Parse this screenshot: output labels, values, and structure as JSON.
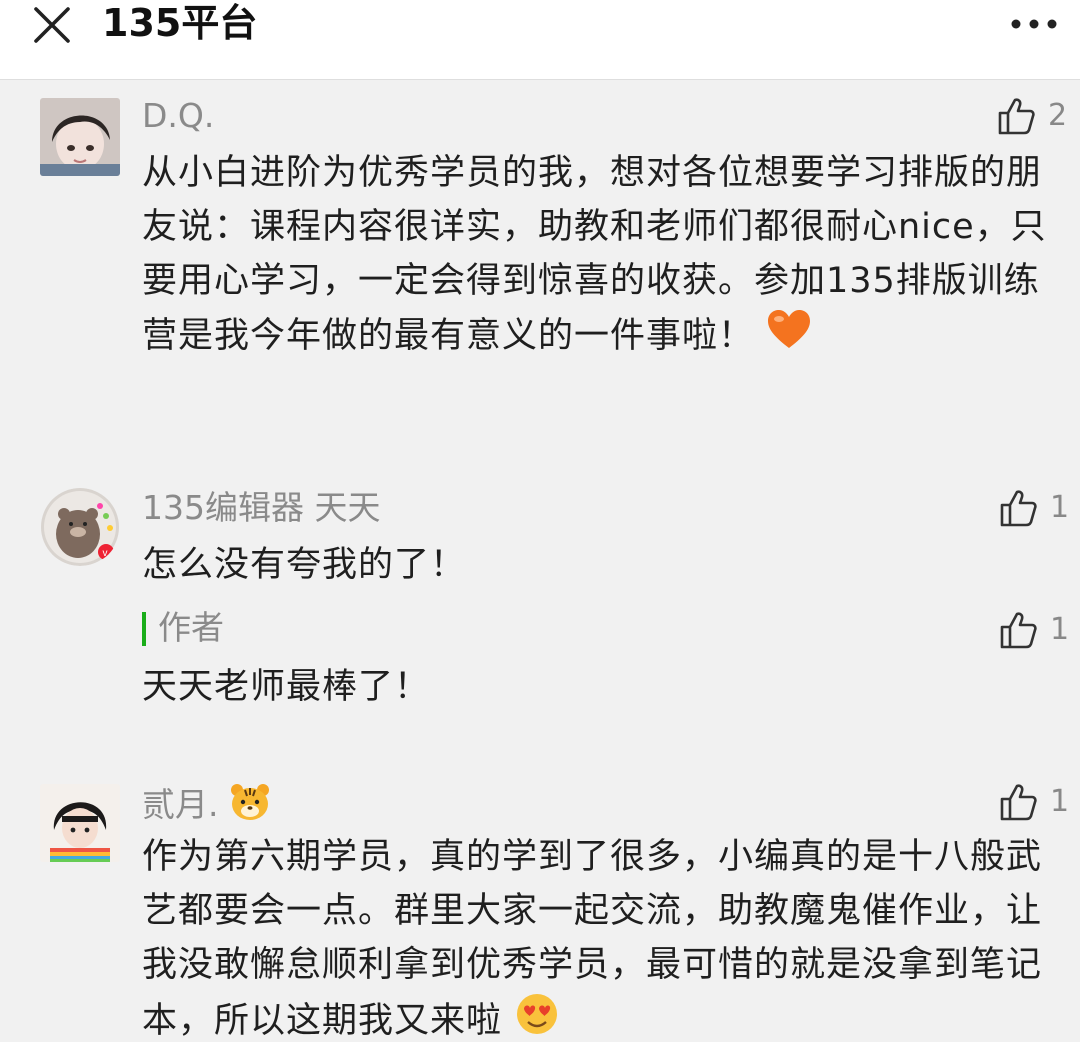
{
  "header": {
    "title": "135平台",
    "close_icon": "close-icon",
    "more_icon": "more-icon"
  },
  "colors": {
    "background": "#f1f1f1",
    "header_bg": "#ffffff",
    "nickname": "#8a8a8a",
    "text": "#1f1f1f",
    "author_accent": "#1aad19"
  },
  "comments": [
    {
      "nickname": "D.Q.",
      "likes": "2",
      "text": "从小白进阶为优秀学员的我，想对各位想要学习排版的朋友说：课程内容很详实，助教和老师们都很耐心nice，只要用心学习，一定会得到惊喜的收获。参加135排版训练营是我今年做的最有意义的一件事啦！",
      "trailing_emoji": "heart-icon"
    },
    {
      "nickname": "135编辑器 天天",
      "likes": "1",
      "text": "怎么没有夸我的了！",
      "reply": {
        "label": "作者",
        "likes": "1",
        "text": "天天老师最棒了！"
      }
    },
    {
      "nickname": "贰月.",
      "nickname_emoji": "tiger-face-icon",
      "likes": "1",
      "text": "作为第六期学员，真的学到了很多，小编真的是十八般武艺都要会一点。群里大家一起交流，助教魔鬼催作业，让我没敢懈怠顺利拿到优秀学员，最可惜的就是没拿到笔记本，所以这期我又来啦",
      "trailing_emoji": "heart-eyes-face-icon"
    }
  ]
}
